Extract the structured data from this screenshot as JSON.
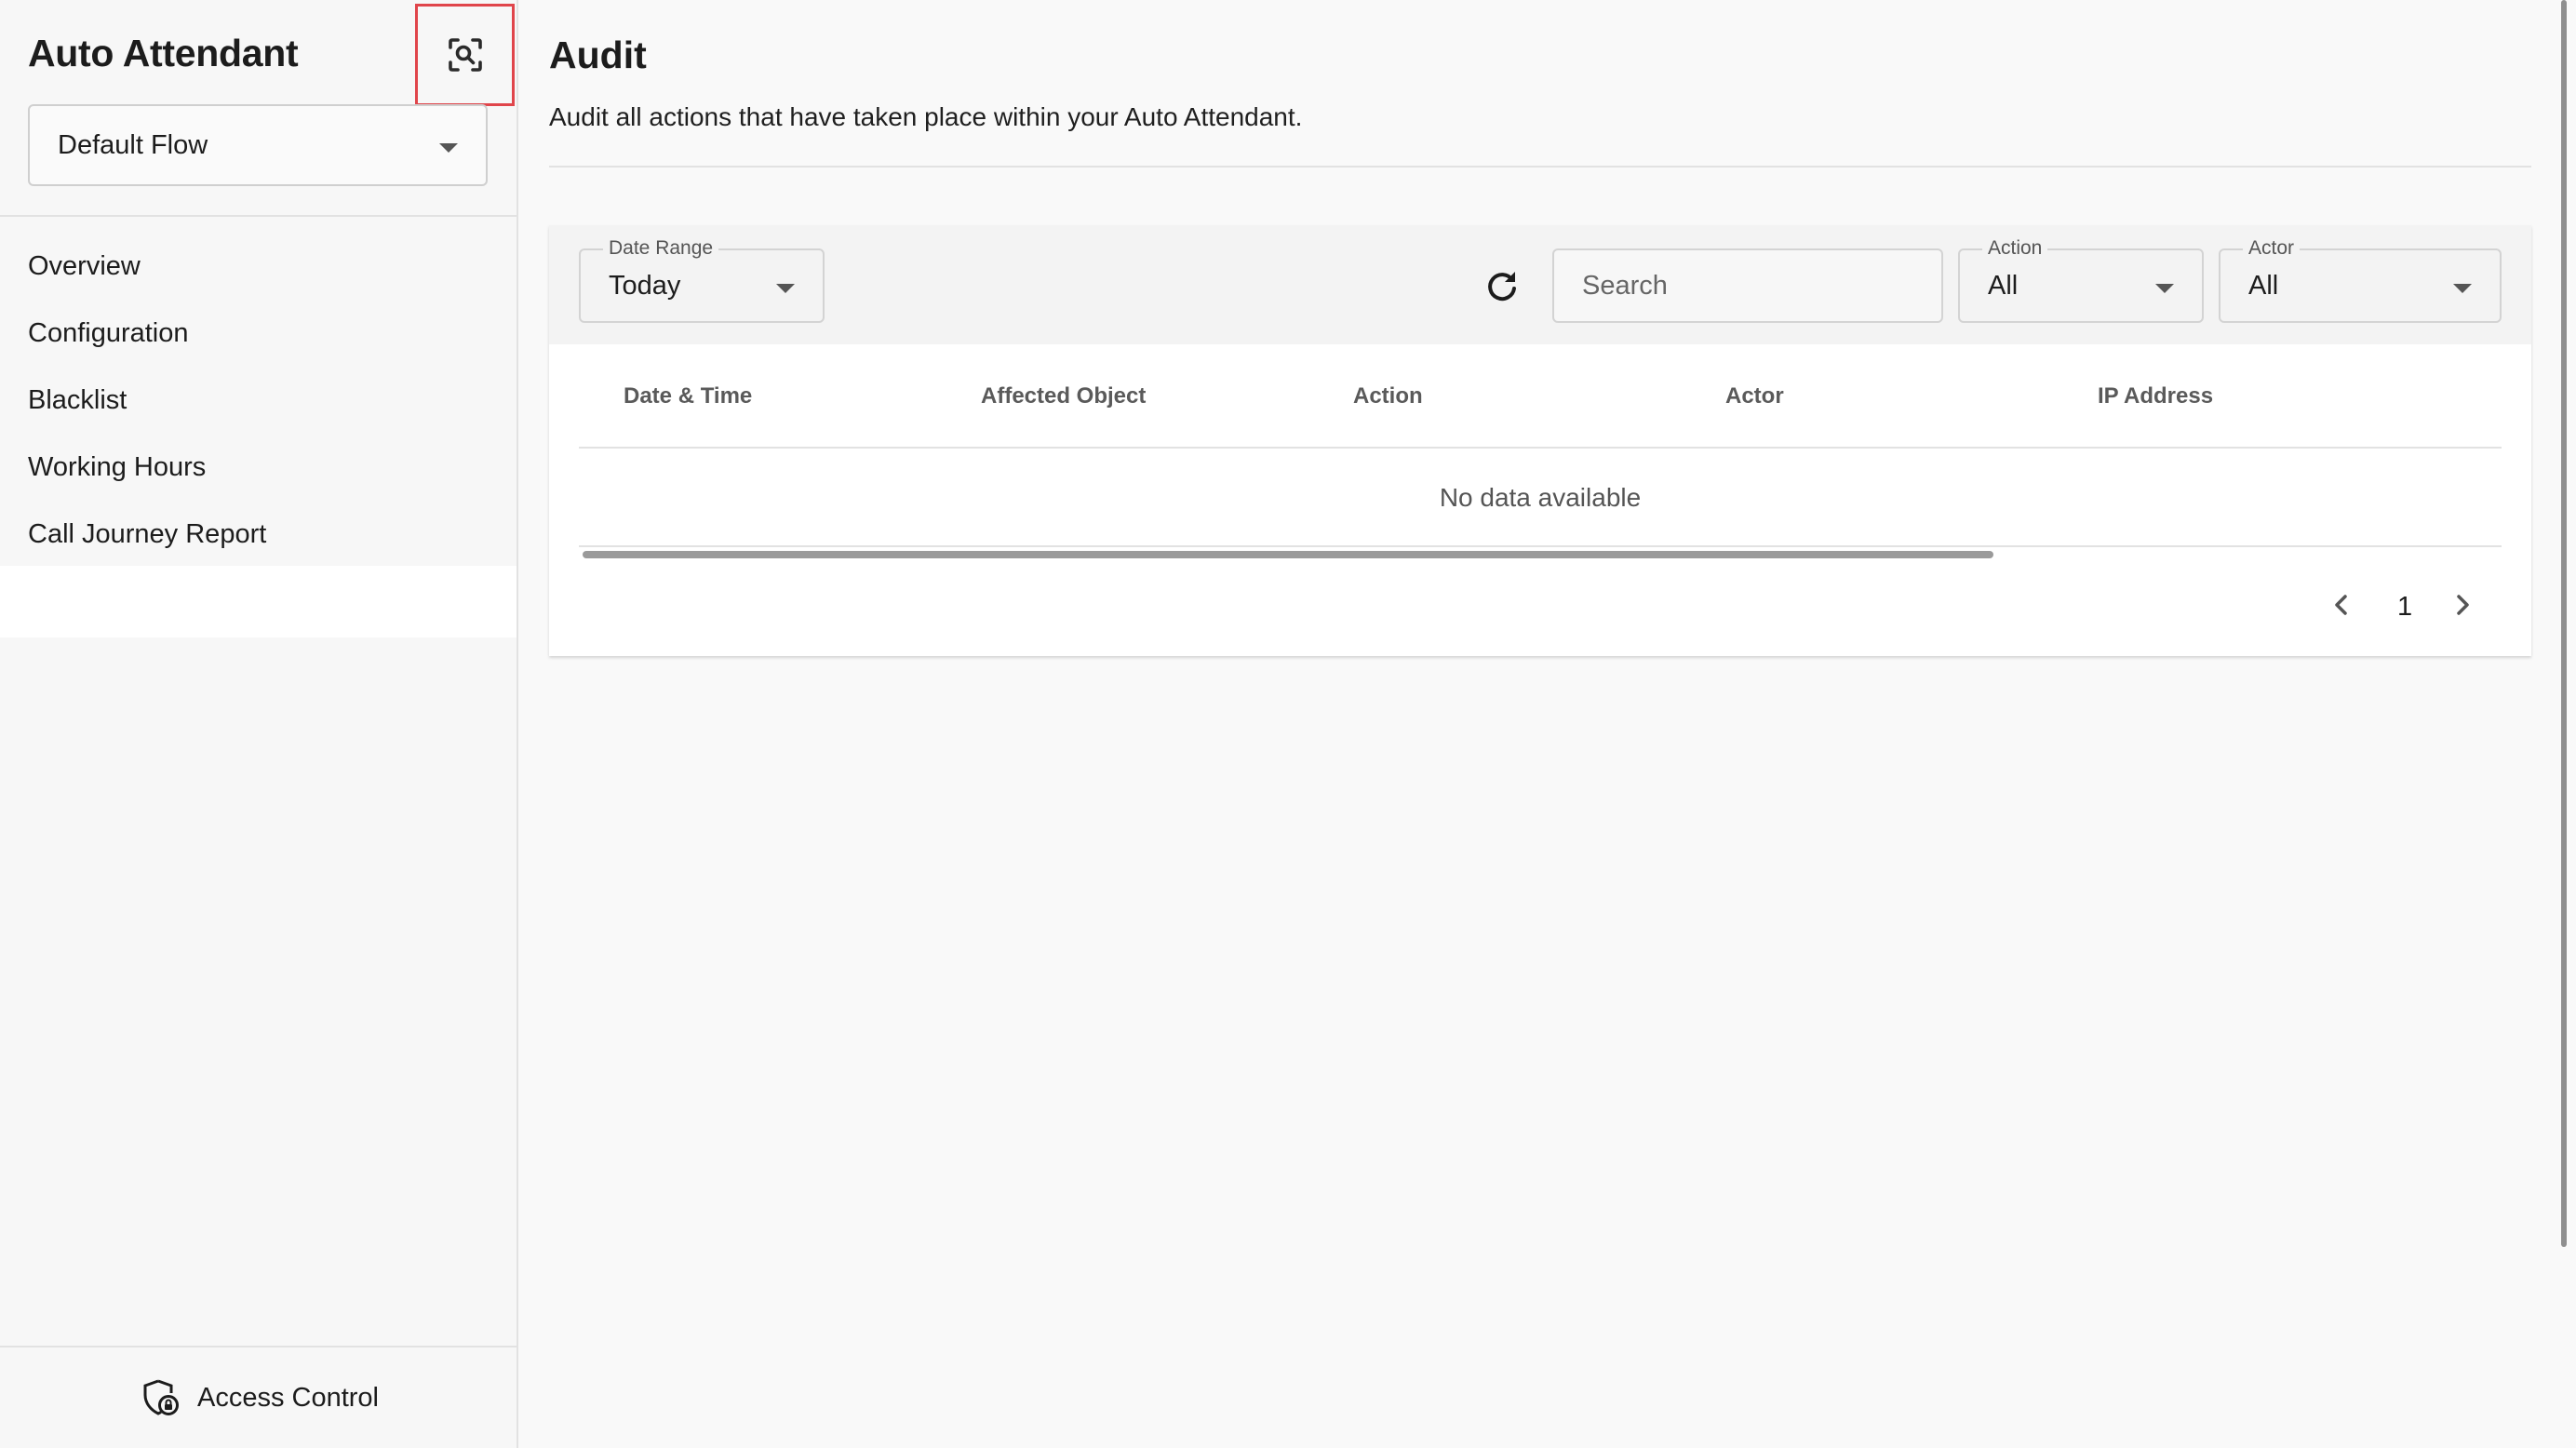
{
  "sidebar": {
    "title": "Auto Attendant",
    "flow_select": {
      "value": "Default Flow"
    },
    "items": [
      {
        "label": "Overview"
      },
      {
        "label": "Configuration"
      },
      {
        "label": "Blacklist"
      },
      {
        "label": "Working Hours"
      },
      {
        "label": "Call Journey Report"
      }
    ],
    "footer": {
      "label": "Access Control",
      "icon": "shield-lock-icon"
    },
    "scan_icon": "scan-search-icon"
  },
  "main": {
    "title": "Audit",
    "description": "Audit all actions that have taken place within your Auto Attendant.",
    "filters": {
      "date_range": {
        "label": "Date Range",
        "value": "Today"
      },
      "search": {
        "placeholder": "Search"
      },
      "action": {
        "label": "Action",
        "value": "All"
      },
      "actor": {
        "label": "Actor",
        "value": "All"
      }
    },
    "table": {
      "columns": [
        "Date & Time",
        "Affected Object",
        "Action",
        "Actor",
        "IP Address"
      ],
      "rows": [],
      "empty_text": "No data available"
    },
    "pagination": {
      "page": "1"
    }
  },
  "colors": {
    "highlight_border": "#e0454b",
    "background": "#f9f9f9",
    "toolbar": "#f3f3f3"
  }
}
